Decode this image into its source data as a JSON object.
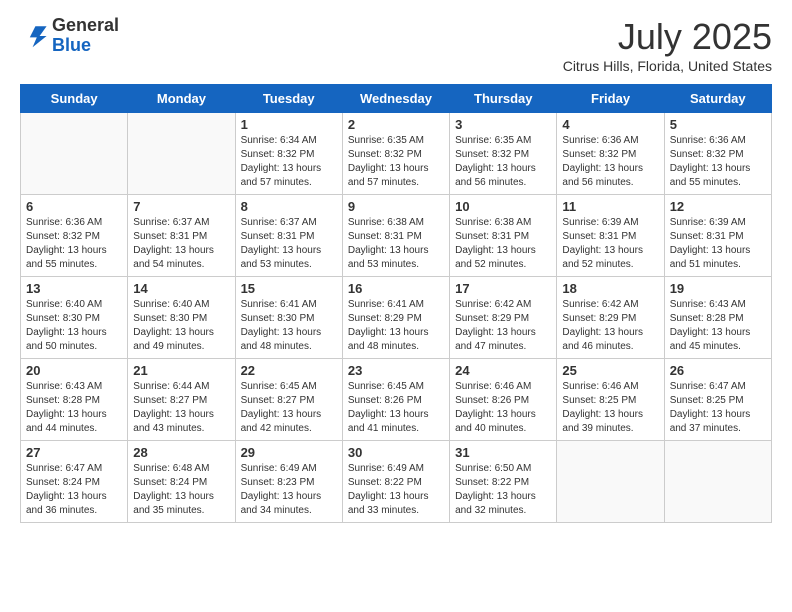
{
  "header": {
    "logo_general": "General",
    "logo_blue": "Blue",
    "month_title": "July 2025",
    "subtitle": "Citrus Hills, Florida, United States"
  },
  "weekdays": [
    "Sunday",
    "Monday",
    "Tuesday",
    "Wednesday",
    "Thursday",
    "Friday",
    "Saturday"
  ],
  "weeks": [
    [
      {
        "day": "",
        "info": ""
      },
      {
        "day": "",
        "info": ""
      },
      {
        "day": "1",
        "info": "Sunrise: 6:34 AM\nSunset: 8:32 PM\nDaylight: 13 hours and 57 minutes."
      },
      {
        "day": "2",
        "info": "Sunrise: 6:35 AM\nSunset: 8:32 PM\nDaylight: 13 hours and 57 minutes."
      },
      {
        "day": "3",
        "info": "Sunrise: 6:35 AM\nSunset: 8:32 PM\nDaylight: 13 hours and 56 minutes."
      },
      {
        "day": "4",
        "info": "Sunrise: 6:36 AM\nSunset: 8:32 PM\nDaylight: 13 hours and 56 minutes."
      },
      {
        "day": "5",
        "info": "Sunrise: 6:36 AM\nSunset: 8:32 PM\nDaylight: 13 hours and 55 minutes."
      }
    ],
    [
      {
        "day": "6",
        "info": "Sunrise: 6:36 AM\nSunset: 8:32 PM\nDaylight: 13 hours and 55 minutes."
      },
      {
        "day": "7",
        "info": "Sunrise: 6:37 AM\nSunset: 8:31 PM\nDaylight: 13 hours and 54 minutes."
      },
      {
        "day": "8",
        "info": "Sunrise: 6:37 AM\nSunset: 8:31 PM\nDaylight: 13 hours and 53 minutes."
      },
      {
        "day": "9",
        "info": "Sunrise: 6:38 AM\nSunset: 8:31 PM\nDaylight: 13 hours and 53 minutes."
      },
      {
        "day": "10",
        "info": "Sunrise: 6:38 AM\nSunset: 8:31 PM\nDaylight: 13 hours and 52 minutes."
      },
      {
        "day": "11",
        "info": "Sunrise: 6:39 AM\nSunset: 8:31 PM\nDaylight: 13 hours and 52 minutes."
      },
      {
        "day": "12",
        "info": "Sunrise: 6:39 AM\nSunset: 8:31 PM\nDaylight: 13 hours and 51 minutes."
      }
    ],
    [
      {
        "day": "13",
        "info": "Sunrise: 6:40 AM\nSunset: 8:30 PM\nDaylight: 13 hours and 50 minutes."
      },
      {
        "day": "14",
        "info": "Sunrise: 6:40 AM\nSunset: 8:30 PM\nDaylight: 13 hours and 49 minutes."
      },
      {
        "day": "15",
        "info": "Sunrise: 6:41 AM\nSunset: 8:30 PM\nDaylight: 13 hours and 48 minutes."
      },
      {
        "day": "16",
        "info": "Sunrise: 6:41 AM\nSunset: 8:29 PM\nDaylight: 13 hours and 48 minutes."
      },
      {
        "day": "17",
        "info": "Sunrise: 6:42 AM\nSunset: 8:29 PM\nDaylight: 13 hours and 47 minutes."
      },
      {
        "day": "18",
        "info": "Sunrise: 6:42 AM\nSunset: 8:29 PM\nDaylight: 13 hours and 46 minutes."
      },
      {
        "day": "19",
        "info": "Sunrise: 6:43 AM\nSunset: 8:28 PM\nDaylight: 13 hours and 45 minutes."
      }
    ],
    [
      {
        "day": "20",
        "info": "Sunrise: 6:43 AM\nSunset: 8:28 PM\nDaylight: 13 hours and 44 minutes."
      },
      {
        "day": "21",
        "info": "Sunrise: 6:44 AM\nSunset: 8:27 PM\nDaylight: 13 hours and 43 minutes."
      },
      {
        "day": "22",
        "info": "Sunrise: 6:45 AM\nSunset: 8:27 PM\nDaylight: 13 hours and 42 minutes."
      },
      {
        "day": "23",
        "info": "Sunrise: 6:45 AM\nSunset: 8:26 PM\nDaylight: 13 hours and 41 minutes."
      },
      {
        "day": "24",
        "info": "Sunrise: 6:46 AM\nSunset: 8:26 PM\nDaylight: 13 hours and 40 minutes."
      },
      {
        "day": "25",
        "info": "Sunrise: 6:46 AM\nSunset: 8:25 PM\nDaylight: 13 hours and 39 minutes."
      },
      {
        "day": "26",
        "info": "Sunrise: 6:47 AM\nSunset: 8:25 PM\nDaylight: 13 hours and 37 minutes."
      }
    ],
    [
      {
        "day": "27",
        "info": "Sunrise: 6:47 AM\nSunset: 8:24 PM\nDaylight: 13 hours and 36 minutes."
      },
      {
        "day": "28",
        "info": "Sunrise: 6:48 AM\nSunset: 8:24 PM\nDaylight: 13 hours and 35 minutes."
      },
      {
        "day": "29",
        "info": "Sunrise: 6:49 AM\nSunset: 8:23 PM\nDaylight: 13 hours and 34 minutes."
      },
      {
        "day": "30",
        "info": "Sunrise: 6:49 AM\nSunset: 8:22 PM\nDaylight: 13 hours and 33 minutes."
      },
      {
        "day": "31",
        "info": "Sunrise: 6:50 AM\nSunset: 8:22 PM\nDaylight: 13 hours and 32 minutes."
      },
      {
        "day": "",
        "info": ""
      },
      {
        "day": "",
        "info": ""
      }
    ]
  ]
}
